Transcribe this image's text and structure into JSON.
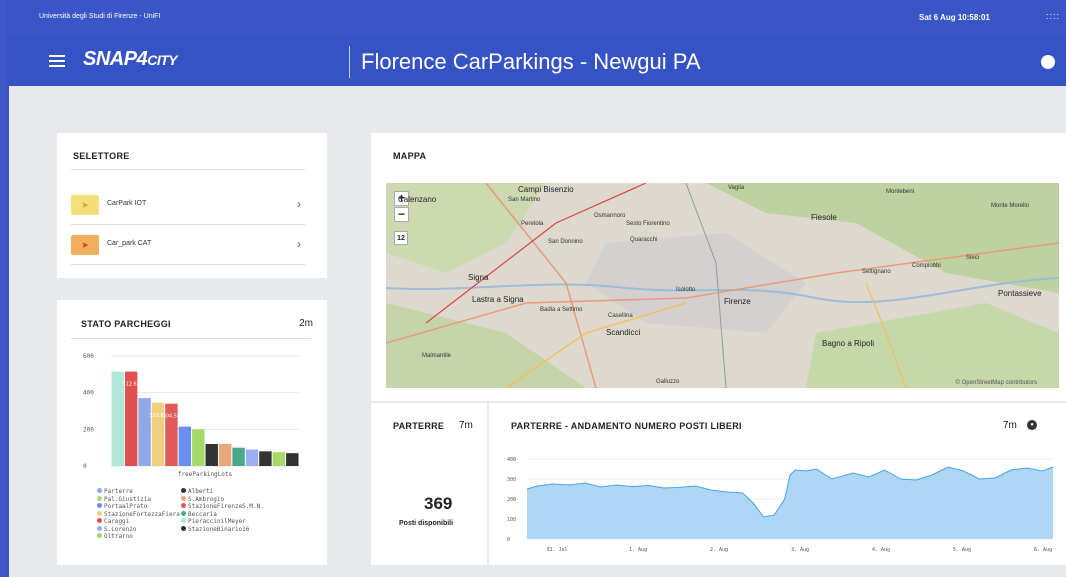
{
  "topbar": {
    "university": "Università degli Studi di Firenze - UniFI",
    "clock": "Sat 6 Aug 10:58:01",
    "dots": "::::"
  },
  "header": {
    "logo_main": "SNAP4",
    "logo_suffix": "CITY",
    "title": "Florence CarParkings - Newgui PA"
  },
  "selettore": {
    "title": "SELETTORE",
    "items": [
      {
        "label": "CarPark IOT",
        "color": "#f4e07a",
        "icon": "navigation-arrow-icon"
      },
      {
        "label": "Car_park CAT",
        "color": "#f0b060",
        "icon": "navigation-arrow-icon"
      }
    ]
  },
  "mappa": {
    "title": "MAPPA",
    "zoom_in": "+",
    "zoom_out": "−",
    "zoom_level": "12",
    "attribution": "© OpenStreetMap contributors",
    "places": [
      "Campi Bisenzio",
      "San Martino",
      "Calenzano",
      "Osmannoro",
      "Sesto Fiorentino",
      "Fiesole",
      "Signa",
      "Lastra a Signa",
      "Firenze",
      "Scandicci",
      "Bagno a Ripoli",
      "Settignano",
      "Pontassieve",
      "Montebeni",
      "Quaracchi",
      "Galluzzo",
      "Isolotto",
      "Casellina",
      "Badia a Settimo",
      "San Donnino",
      "Malmantile",
      "Compiobbi",
      "Sieci",
      "Vaglia",
      "Peretola",
      "Monte Morello"
    ]
  },
  "stato": {
    "title": "STATO PARCHEGGI",
    "refresh": "2m",
    "legend": [
      {
        "name": "Parterre",
        "color": "#8fa8e8"
      },
      {
        "name": "Alberti",
        "color": "#333333"
      },
      {
        "name": "Pal.Giustizia",
        "color": "#a6d96a"
      },
      {
        "name": "S.Ambrogio",
        "color": "#e8a87c"
      },
      {
        "name": "PortaalPrato",
        "color": "#6c8ef0"
      },
      {
        "name": "StazioneFirenzeS.M.N.",
        "color": "#e05a5a"
      },
      {
        "name": "StazioneFortezzaFiera",
        "color": "#f0d080"
      },
      {
        "name": "Beccaria",
        "color": "#4aa88a"
      },
      {
        "name": "Careggi",
        "color": "#e05050"
      },
      {
        "name": "PieraccinilMeyer",
        "color": "#b0e8d8"
      },
      {
        "name": "S.Lorenzo",
        "color": "#9ab0f0"
      },
      {
        "name": "StazioneBinario16",
        "color": "#333333"
      },
      {
        "name": "Oltrarno",
        "color": "#a6d96a"
      }
    ]
  },
  "chart_data": [
    {
      "type": "bar",
      "xlabel": "freeParkingLots",
      "ylim": [
        0,
        600
      ],
      "yticks": [
        "0",
        "200",
        "400",
        "600"
      ],
      "values": [
        515,
        515,
        370,
        345,
        340,
        215,
        200,
        120,
        120,
        100,
        90,
        80,
        75,
        70
      ],
      "colors": [
        "#b0e8d8",
        "#e05050",
        "#8fa8e8",
        "#f0d080",
        "#e05a5a",
        "#6c8ef0",
        "#a6d96a",
        "#333333",
        "#e8a87c",
        "#4aa88a",
        "#9ab0f0",
        "#333333",
        "#a6d96a",
        "#333333"
      ],
      "data_labels": [
        "",
        "512.63",
        "",
        "333.68",
        "304.54",
        "",
        "",
        "",
        "",
        "",
        "",
        "",
        "",
        ""
      ],
      "legend_position": "bottom"
    },
    {
      "type": "area",
      "title": "PARTERRE - ANDAMENTO NUMERO POSTI LIBERI",
      "ylim": [
        0,
        400
      ],
      "yticks": [
        "0",
        "100",
        "200",
        "300",
        "400"
      ],
      "xticks": [
        "31. Jul",
        "1. Aug",
        "2. Aug",
        "3. Aug",
        "4. Aug",
        "5. Aug",
        "6. Aug"
      ],
      "x": [
        0,
        0.02,
        0.05,
        0.08,
        0.11,
        0.14,
        0.17,
        0.2,
        0.23,
        0.26,
        0.29,
        0.32,
        0.35,
        0.38,
        0.41,
        0.43,
        0.45,
        0.47,
        0.49,
        0.5,
        0.51,
        0.53,
        0.55,
        0.58,
        0.62,
        0.65,
        0.68,
        0.71,
        0.74,
        0.77,
        0.8,
        0.83,
        0.86,
        0.89,
        0.92,
        0.95,
        0.98,
        1.0
      ],
      "values": [
        250,
        265,
        275,
        270,
        280,
        260,
        270,
        262,
        268,
        255,
        258,
        265,
        245,
        235,
        230,
        180,
        110,
        120,
        200,
        320,
        345,
        340,
        350,
        300,
        330,
        310,
        345,
        300,
        295,
        320,
        360,
        340,
        300,
        305,
        345,
        355,
        340,
        360
      ],
      "refresh": "7m"
    }
  ],
  "parterre": {
    "title": "PARTERRE",
    "refresh": "7m",
    "value": "369",
    "caption": "Posti disponibili"
  }
}
